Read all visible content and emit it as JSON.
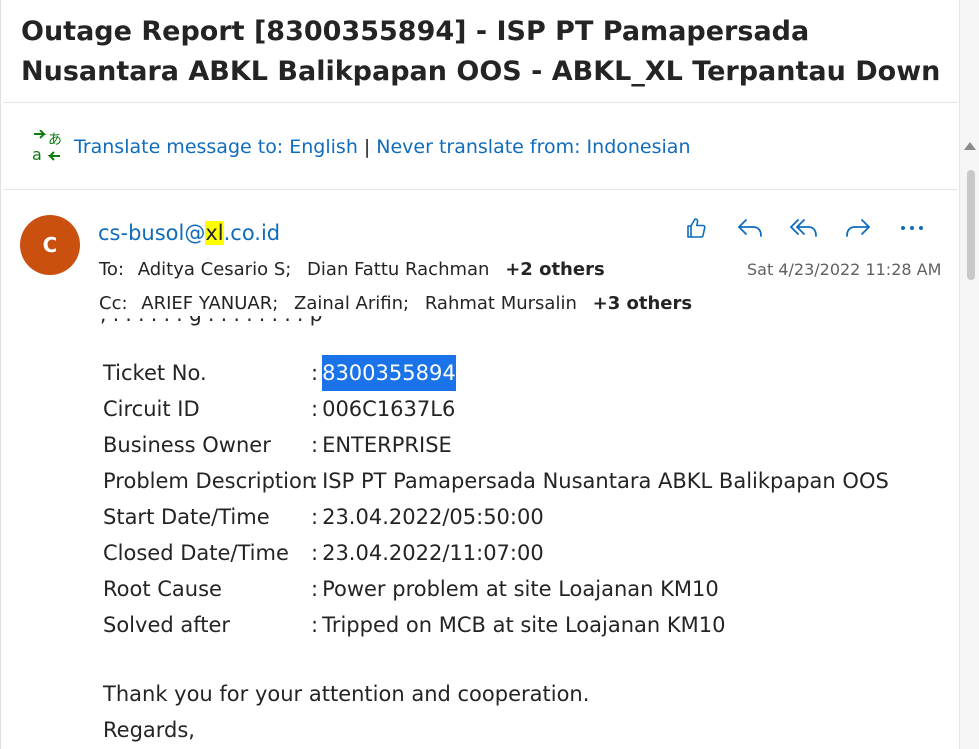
{
  "subject": "Outage Report [8300355894] - ISP PT Pamapersada Nusantara ABKL Balikpapan OOS - ABKL_XL Terpantau Down",
  "translate": {
    "icon": "translate-icon",
    "translate_link": "Translate message to: English",
    "separator": "|",
    "never_link": "Never translate from: Indonesian"
  },
  "message": {
    "avatar_initial": "C",
    "avatar_color": "#ca5010",
    "sender_before": "cs-busol@",
    "sender_highlight": "xl",
    "sender_after": ".co.id",
    "date": "Sat 4/23/2022 11:28 AM",
    "to_label": "To:",
    "to": [
      "Aditya Cesario S;",
      "Dian Fattu Rachman"
    ],
    "to_more": "+2 others",
    "cc_label": "Cc:",
    "cc": [
      "ARIEF YANUAR;",
      "Zainal Arifin;",
      "Rahmat Mursalin"
    ],
    "cc_more": "+3 others",
    "actions": [
      "like-icon",
      "reply-icon",
      "reply-all-icon",
      "forward-icon",
      "more-icon"
    ]
  },
  "body": {
    "clipped_line": ", . . . . . . g . . . . . . . . p",
    "ticket_label": "Ticket No.",
    "ticket_value": "8300355894",
    "rows": [
      {
        "key": "Circuit ID",
        "value": "006C1637L6"
      },
      {
        "key": "Business Owner",
        "value": "ENTERPRISE"
      },
      {
        "key": "Problem Description",
        "value": "ISP PT Pamapersada Nusantara ABKL Balikpapan OOS"
      },
      {
        "key": "Start Date/Time",
        "value": "23.04.2022/05:50:00"
      },
      {
        "key": "Closed Date/Time",
        "value": "23.04.2022/11:07:00"
      },
      {
        "key": "Root Cause",
        "value": "Power problem at site Loajanan KM10"
      },
      {
        "key": "Solved after",
        "value": "Tripped on MCB at site Loajanan KM10"
      }
    ],
    "colon": ":",
    "thanks": "Thank you for your attention and cooperation.",
    "regards": "Regards,"
  }
}
